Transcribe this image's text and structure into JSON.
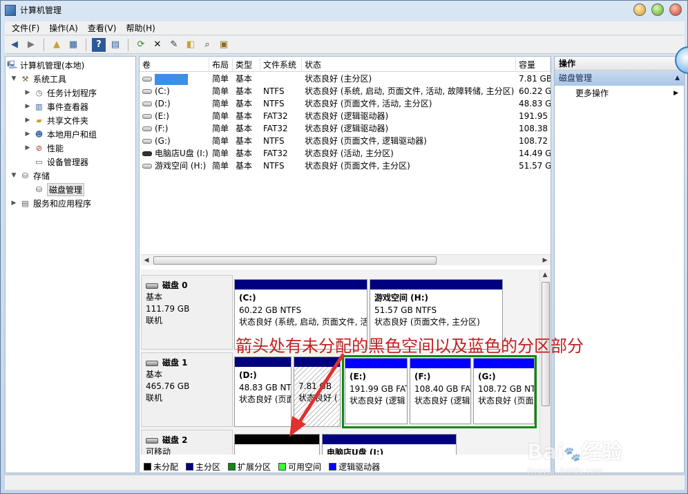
{
  "window": {
    "title": "计算机管理"
  },
  "menu": [
    "文件(F)",
    "操作(A)",
    "查看(V)",
    "帮助(H)"
  ],
  "toolbar": [
    "back-arrow-icon",
    "forward-arrow-icon",
    "up-folder-icon",
    "show-tree-icon",
    "help-icon",
    "properties-pane-icon",
    "refresh-icon",
    "delete-icon",
    "properties-icon",
    "open-folder-icon",
    "search-icon",
    "checkup-icon"
  ],
  "tree": [
    {
      "label": "计算机管理(本地)",
      "level": 0,
      "expander": "",
      "icon": "computer-icon"
    },
    {
      "label": "系统工具",
      "level": 1,
      "expander": "▼",
      "icon": "tools-icon"
    },
    {
      "label": "任务计划程序",
      "level": 2,
      "expander": "▶",
      "icon": "clock-icon"
    },
    {
      "label": "事件查看器",
      "level": 2,
      "expander": "▶",
      "icon": "event-viewer-icon"
    },
    {
      "label": "共享文件夹",
      "level": 2,
      "expander": "▶",
      "icon": "shared-folder-icon"
    },
    {
      "label": "本地用户和组",
      "level": 2,
      "expander": "▶",
      "icon": "users-icon"
    },
    {
      "label": "性能",
      "level": 2,
      "expander": "▶",
      "icon": "performance-icon"
    },
    {
      "label": "设备管理器",
      "level": 2,
      "expander": "",
      "icon": "device-manager-icon"
    },
    {
      "label": "存储",
      "level": 1,
      "expander": "▼",
      "icon": "storage-icon"
    },
    {
      "label": "磁盘管理",
      "level": 2,
      "expander": "",
      "icon": "disk-management-icon",
      "selected": true
    },
    {
      "label": "服务和应用程序",
      "level": 1,
      "expander": "▶",
      "icon": "services-icon"
    }
  ],
  "volume_table": {
    "headers": [
      "卷",
      "布局",
      "类型",
      "文件系统",
      "状态",
      "容量"
    ],
    "rows": [
      {
        "name": "",
        "layout": "简单",
        "type": "基本",
        "fs": "",
        "status": "状态良好 (主分区)",
        "capacity": "7.81 GB",
        "hidden": true
      },
      {
        "name": "(C:)",
        "layout": "简单",
        "type": "基本",
        "fs": "NTFS",
        "status": "状态良好 (系统, 启动, 页面文件, 活动, 故障转储, 主分区)",
        "capacity": "60.22 GB"
      },
      {
        "name": "(D:)",
        "layout": "简单",
        "type": "基本",
        "fs": "NTFS",
        "status": "状态良好 (页面文件, 活动, 主分区)",
        "capacity": "48.83 GB"
      },
      {
        "name": "(E:)",
        "layout": "简单",
        "type": "基本",
        "fs": "FAT32",
        "status": "状态良好 (逻辑驱动器)",
        "capacity": "191.95 GB"
      },
      {
        "name": "(F:)",
        "layout": "简单",
        "type": "基本",
        "fs": "FAT32",
        "status": "状态良好 (逻辑驱动器)",
        "capacity": "108.38 GB"
      },
      {
        "name": "(G:)",
        "layout": "简单",
        "type": "基本",
        "fs": "NTFS",
        "status": "状态良好 (页面文件, 逻辑驱动器)",
        "capacity": "108.72 GB"
      },
      {
        "name": "电脑店U盘 (I:)",
        "layout": "简单",
        "type": "基本",
        "fs": "FAT32",
        "status": "状态良好 (活动, 主分区)",
        "capacity": "14.49 GB",
        "dark": true
      },
      {
        "name": "游戏空间 (H:)",
        "layout": "简单",
        "type": "基本",
        "fs": "NTFS",
        "status": "状态良好 (页面文件, 主分区)",
        "capacity": "51.57 GB"
      }
    ]
  },
  "disks": [
    {
      "name": "磁盘 0",
      "kind": "基本",
      "size": "111.79 GB",
      "state": "联机",
      "partitions": [
        {
          "title": "(C:)",
          "size_fs": "60.22 GB NTFS",
          "status": "状态良好 (系统, 启动, 页面文件, 活",
          "bar": "#00007f"
        },
        {
          "title": "游戏空间 (H:)",
          "size_fs": "51.57 GB NTFS",
          "status": "状态良好 (页面文件, 主分区)",
          "bar": "#00007f"
        }
      ]
    },
    {
      "name": "磁盘 1",
      "kind": "基本",
      "size": "465.76 GB",
      "state": "联机",
      "partitions": [
        {
          "title": "(D:)",
          "size_fs": "48.83 GB NTFS",
          "status": "状态良好 (页面",
          "bar": "#00007f"
        },
        {
          "title": "",
          "size_fs": "7.81 GB",
          "status": "状态良好 (",
          "bar": "#00007f",
          "hatched": true
        },
        {
          "title": "(E:)",
          "size_fs": "191.99 GB FAT32",
          "status": "状态良好 (逻辑",
          "bar": "#0000ff"
        },
        {
          "title": "(F:)",
          "size_fs": "108.40 GB FAT32",
          "status": "状态良好 (逻辑",
          "bar": "#0000ff"
        },
        {
          "title": "(G:)",
          "size_fs": "108.72 GB NTFS",
          "status": "状态良好 (页面",
          "bar": "#0000ff"
        }
      ]
    },
    {
      "name": "磁盘 2",
      "kind": "可移动",
      "size": "",
      "state": "",
      "partitions": [
        {
          "title": "",
          "size_fs": "",
          "status": "",
          "bar": "#000000"
        },
        {
          "title": "电脑店U盘 (I:)",
          "size_fs": "",
          "status": "",
          "bar": "#00007f"
        }
      ]
    }
  ],
  "legend": [
    {
      "label": "未分配",
      "color": "#000000"
    },
    {
      "label": "主分区",
      "color": "#00007f"
    },
    {
      "label": "扩展分区",
      "color": "#118811"
    },
    {
      "label": "可用空间",
      "color": "#33ff33"
    },
    {
      "label": "逻辑驱动器",
      "color": "#0000ff"
    }
  ],
  "actions": {
    "header": "操作",
    "section": "磁盘管理",
    "items": [
      "更多操作"
    ]
  },
  "annotation": "箭头处有未分配的黑色空间以及蓝色的分区部分",
  "watermark": {
    "text": "Bai",
    "text2": "经验",
    "sub": "jingyan.baidu.com"
  }
}
